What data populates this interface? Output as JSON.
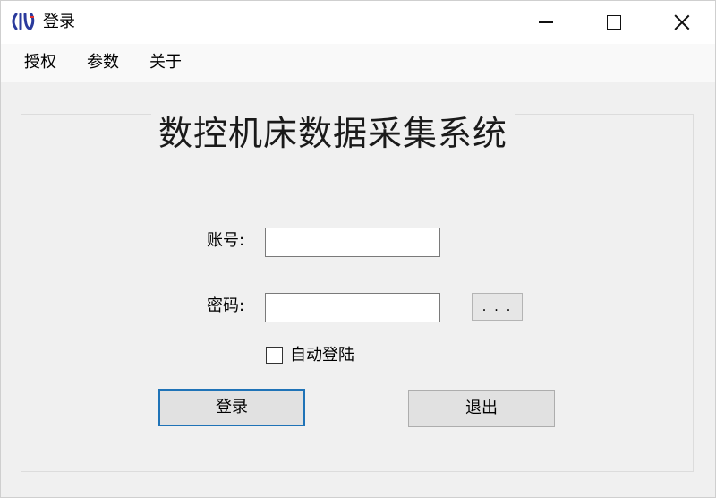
{
  "window": {
    "title": "登录",
    "icon": "app-logo-icon",
    "controls": {
      "minimize_icon": "minimize-icon",
      "maximize_icon": "maximize-icon",
      "close_icon": "close-icon"
    }
  },
  "menu": {
    "items": [
      {
        "label": "授权"
      },
      {
        "label": "参数"
      },
      {
        "label": "关于"
      }
    ]
  },
  "form": {
    "heading": "数控机床数据采集系统",
    "account_label": "账号:",
    "account_value": "",
    "password_label": "密码:",
    "password_value": "",
    "browse_label": ". . .",
    "auto_login_label": "自动登陆",
    "auto_login_checked": false,
    "login_button": "登录",
    "exit_button": "退出"
  },
  "colors": {
    "accent": "#1f73b7",
    "logo": "#2a3a9c",
    "window_bg": "#f0f0f0"
  }
}
